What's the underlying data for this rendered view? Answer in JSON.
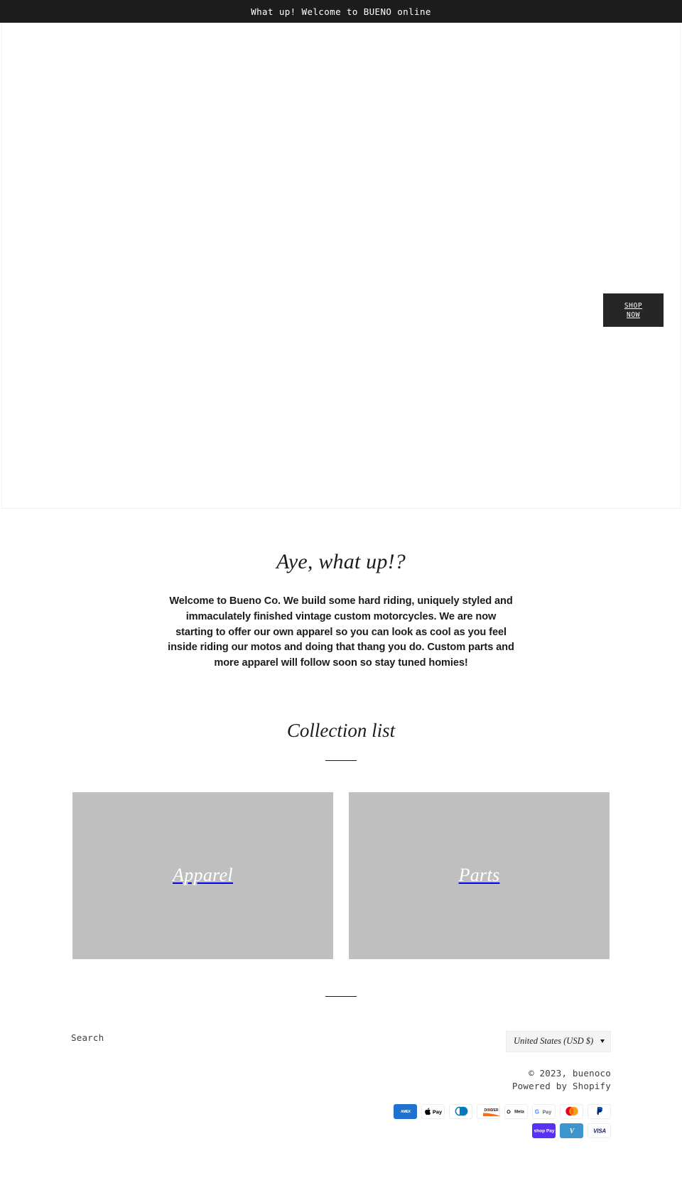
{
  "announcement": {
    "text": "What up! Welcome to BUENO online"
  },
  "hero": {
    "cta_line1": "SHOP",
    "cta_line2": "NOW"
  },
  "richtext": {
    "heading": "Aye, what up!?",
    "body": "Welcome to Bueno Co. We build some hard riding, uniquely styled and immaculately finished vintage custom motorcycles. We are now starting to offer our own apparel so you can look as cool as you feel inside riding our motos and doing that thang you do. Custom parts and more apparel will follow soon so stay tuned homies!"
  },
  "collections": {
    "heading": "Collection list",
    "items": [
      {
        "title": "Apparel",
        "placeholder_color": "#bfbfbf"
      },
      {
        "title": "Parts",
        "placeholder_color": "#bfbfbf"
      }
    ]
  },
  "footer": {
    "links": [
      {
        "label": "Search"
      }
    ],
    "locale": {
      "selected": "United States (USD $)",
      "options": [
        "United States (USD $)"
      ],
      "caret_icon": "chevron-down-icon"
    },
    "copyright": "© 2023, buenoco",
    "powered_by_prefix": "Powered by ",
    "powered_by_link": "Shopify",
    "payment_methods": [
      {
        "name": "American Express",
        "short": "AMEX",
        "key": "amex"
      },
      {
        "name": "Apple Pay",
        "short": "Pay",
        "key": "applepay"
      },
      {
        "name": "Diners Club",
        "short": "",
        "key": "diners"
      },
      {
        "name": "Discover",
        "short": "DISC●VER",
        "key": "discover"
      },
      {
        "name": "Meta Pay",
        "short": "∞Meta",
        "key": "meta"
      },
      {
        "name": "Google Pay",
        "short": "G Pay",
        "key": "googlepay"
      },
      {
        "name": "Mastercard",
        "short": "",
        "key": "mastercard"
      },
      {
        "name": "PayPal",
        "short": "",
        "key": "paypal"
      },
      {
        "name": "Shop Pay",
        "short": "●Pay",
        "key": "shoppay"
      },
      {
        "name": "Venmo",
        "short": "V",
        "key": "venmo"
      },
      {
        "name": "Visa",
        "short": "VISA",
        "key": "visa"
      }
    ]
  },
  "colors": {
    "announcement_bg": "#1c1c1c",
    "button_bg": "#262626",
    "text": "#1c1c1c",
    "muted_text": "#3d3d3d",
    "placeholder": "#bfbfbf"
  }
}
